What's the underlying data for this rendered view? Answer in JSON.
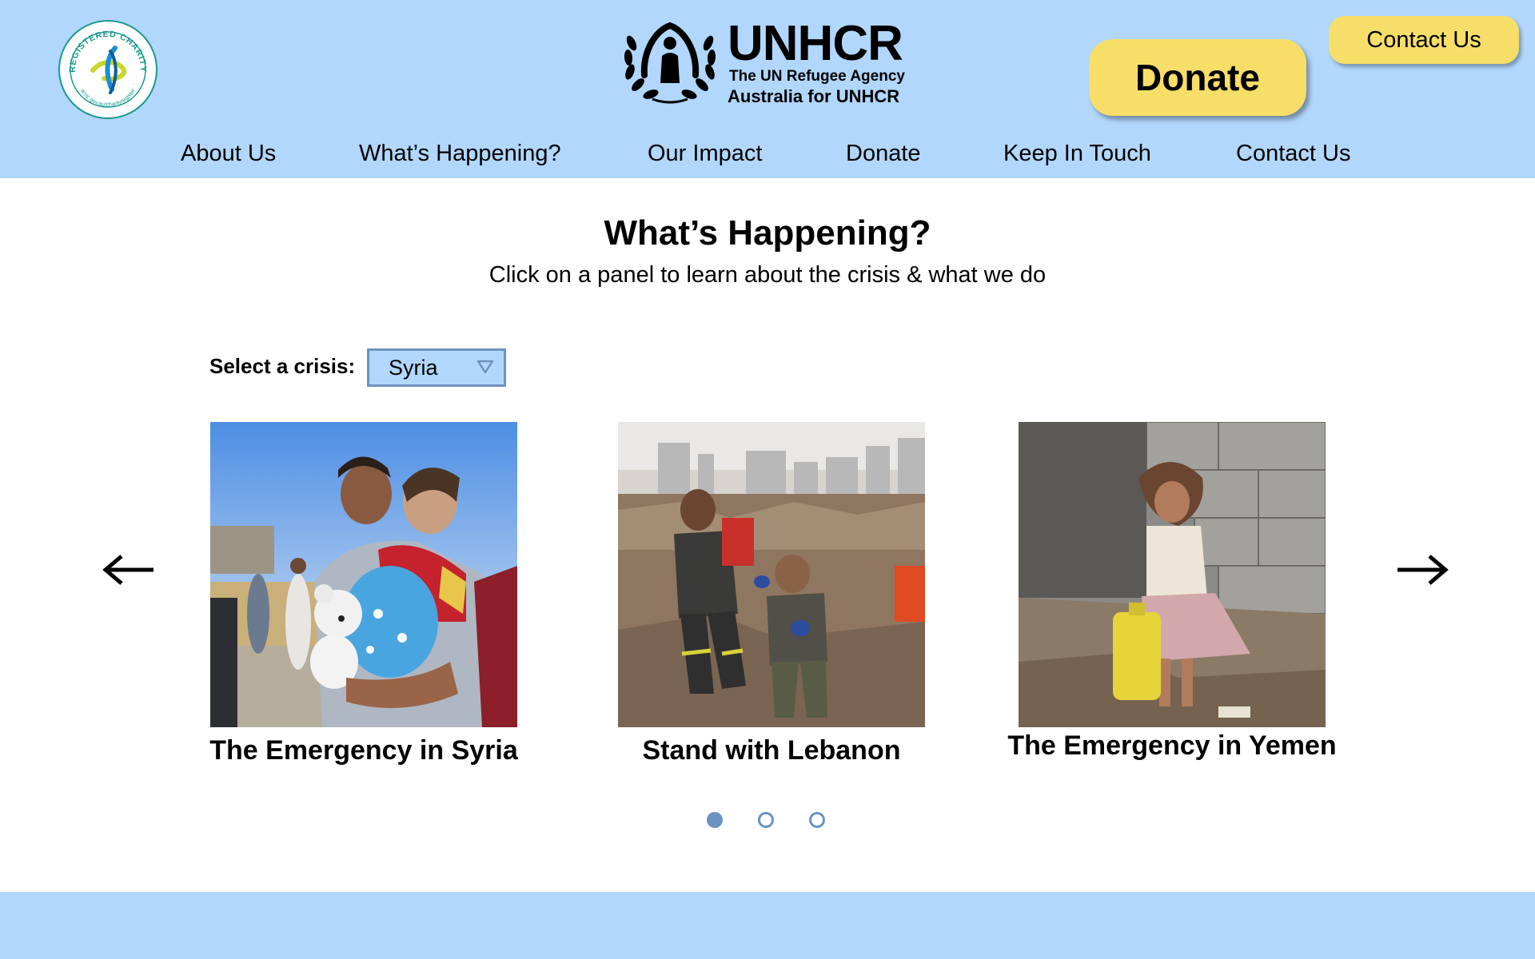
{
  "header": {
    "badge": {
      "text_top": "REGISTERED CHARITY",
      "text_bottom": "acnc.gov.au/charityregister"
    },
    "logo": {
      "title": "UNHCR",
      "subtitle": "The UN Refugee Agency",
      "subtitle2": "Australia for UNHCR"
    },
    "donate_label": "Donate",
    "contact_label": "Contact Us"
  },
  "nav": {
    "items": [
      {
        "label": "About Us"
      },
      {
        "label": "What’s Happening?"
      },
      {
        "label": "Our Impact"
      },
      {
        "label": "Donate"
      },
      {
        "label": "Keep In Touch"
      },
      {
        "label": "Contact Us"
      }
    ]
  },
  "main": {
    "title": "What’s Happening?",
    "subtitle": "Click on a panel to learn about the crisis & what we do",
    "select_label": "Select a crisis:",
    "select_value": "Syria",
    "cards": [
      {
        "caption": "The Emergency in Syria"
      },
      {
        "caption": "Stand with Lebanon"
      },
      {
        "caption": "The Emergency in Yemen"
      }
    ],
    "carousel": {
      "total_pages": 3,
      "active_page": 1
    }
  },
  "colors": {
    "header_bg": "#b1d7fd",
    "button_yellow": "#f7de68",
    "dot_active": "#6c93c0",
    "select_border": "#6f93bd"
  },
  "icons": {
    "prev": "arrow-left-icon",
    "next": "arrow-right-icon",
    "dropdown": "triangle-down-icon"
  }
}
